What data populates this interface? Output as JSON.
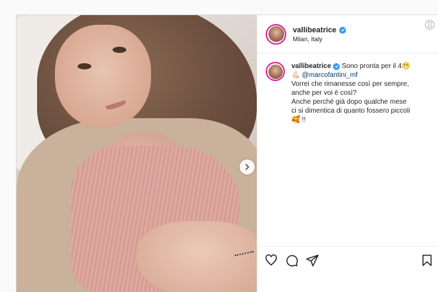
{
  "post": {
    "username": "vallibeatrice",
    "location": "Milan, Italy",
    "caption": {
      "username": "vallibeatrice",
      "line1": "Sono pronta per il 4😁",
      "line2_emoji": "💪🏻",
      "mention": "@marcofantini_mf",
      "line3": "Vorrei che rimanesse così per sempre,",
      "line4": "anche per voi è così?",
      "line5": "Anche perché già dopo qualche mese",
      "line6": "ci si dimentica di quanto fossero piccoli",
      "line7": "🥰 !!"
    }
  },
  "icons": {
    "verified": "verified-badge-icon",
    "logo": "instagram-logo-icon",
    "next": "chevron-right-icon",
    "like": "heart-icon",
    "comment": "comment-icon",
    "share": "send-icon",
    "save": "bookmark-icon"
  },
  "colors": {
    "verified": "#3897f0",
    "mention": "#00376b",
    "border": "#dbdbdb",
    "avatar_ring": "#d6249f"
  }
}
